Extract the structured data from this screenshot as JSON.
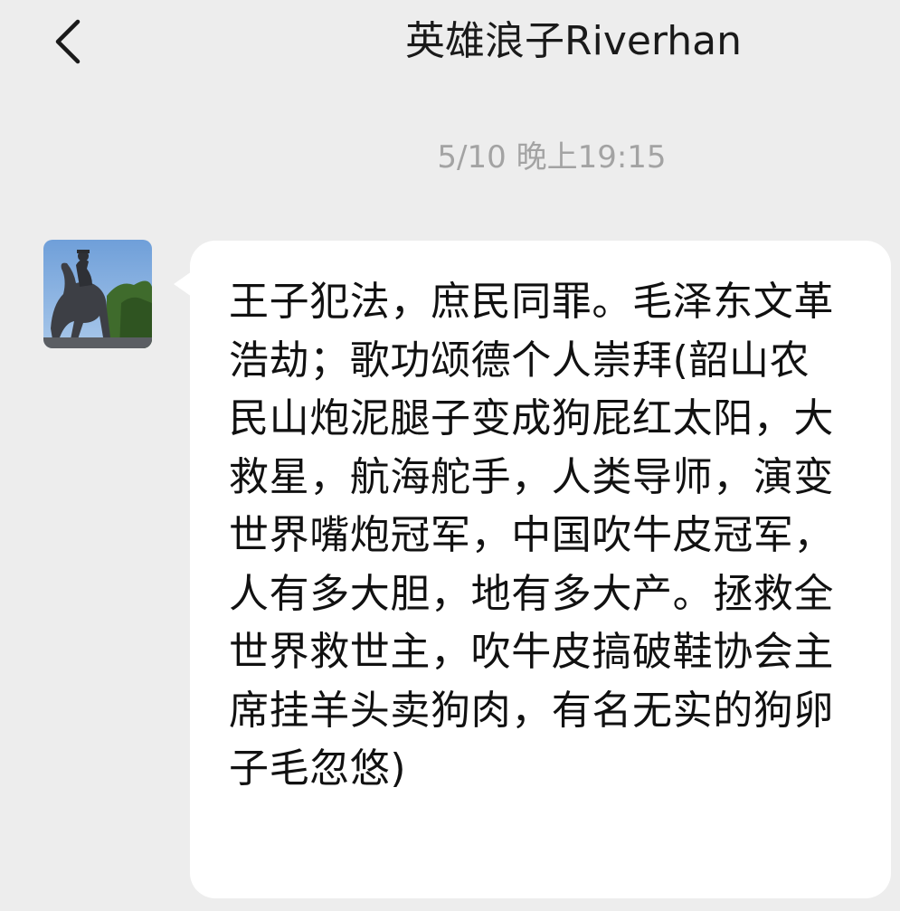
{
  "header": {
    "title": "英雄浪子Riverhan",
    "back_icon": "chevron-left-icon"
  },
  "timestamp": "5/10 晚上19:15",
  "message": {
    "avatar_icon": "equestrian-statue-avatar",
    "text": "王子犯法，庶民同罪。毛泽东文革浩劫；歌功颂德个人崇拜(韶山农民山炮泥腿子变成狗屁红太阳，大救星，航海舵手，人类导师，演变世界嘴炮冠军，中国吹牛皮冠军，人有多大胆，地有多大产。拯救全世界救世主，吹牛皮搞破鞋协会主席挂羊头卖狗肉，有名无实的狗卵子毛忽悠)"
  },
  "colors": {
    "background": "#ededed",
    "bubble": "#ffffff",
    "text": "#111111",
    "timestamp": "#a3a3a3"
  }
}
